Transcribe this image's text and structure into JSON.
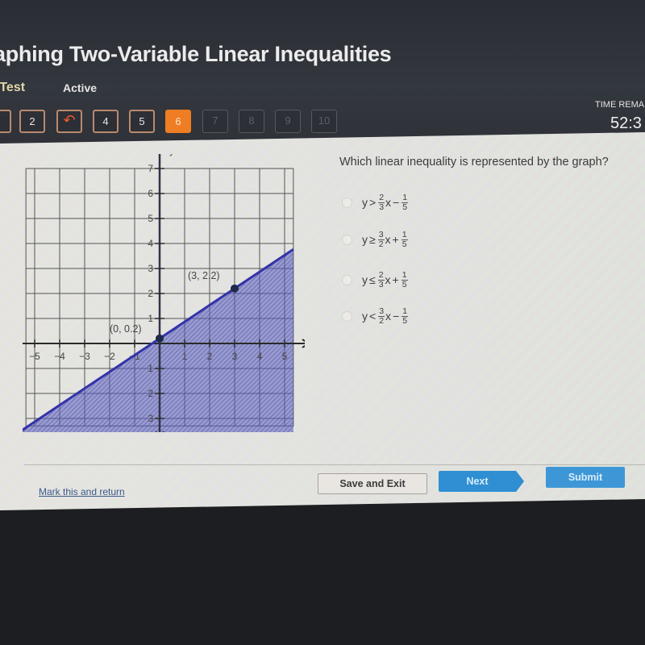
{
  "header": {
    "title": "aphing Two-Variable Linear Inequalities",
    "subtitle": "-Test",
    "status": "Active"
  },
  "question_nav": {
    "items": [
      {
        "label": "",
        "state": "answered"
      },
      {
        "label": "2",
        "state": "answered"
      },
      {
        "label": "↶",
        "state": "flagged",
        "icon": "return-arrow-icon"
      },
      {
        "label": "4",
        "state": "answered"
      },
      {
        "label": "5",
        "state": "answered"
      },
      {
        "label": "6",
        "state": "current"
      },
      {
        "label": "7",
        "state": "disabled"
      },
      {
        "label": "8",
        "state": "disabled"
      },
      {
        "label": "9",
        "state": "disabled"
      },
      {
        "label": "10",
        "state": "disabled"
      }
    ]
  },
  "timer": {
    "label": "TIME REMA",
    "value": "52:3"
  },
  "question": {
    "prompt": "Which linear inequality is represented by the graph?",
    "options": [
      {
        "lhs": "y",
        "op": ">",
        "coef_num": "2",
        "coef_den": "3",
        "var": "x",
        "sign": "−",
        "const_num": "1",
        "const_den": "5"
      },
      {
        "lhs": "y",
        "op": "≥",
        "coef_num": "3",
        "coef_den": "2",
        "var": "x",
        "sign": "+",
        "const_num": "1",
        "const_den": "5"
      },
      {
        "lhs": "y",
        "op": "≤",
        "coef_num": "2",
        "coef_den": "3",
        "var": "x",
        "sign": "+",
        "const_num": "1",
        "const_den": "5"
      },
      {
        "lhs": "y",
        "op": "<",
        "coef_num": "3",
        "coef_den": "2",
        "var": "x",
        "sign": "−",
        "const_num": "1",
        "const_den": "5"
      }
    ]
  },
  "chart_data": {
    "type": "line",
    "title": "",
    "xlabel": "x",
    "ylabel": "y",
    "xlim": [
      -5,
      5
    ],
    "ylim": [
      -3,
      7
    ],
    "x_ticks": [
      -5,
      -4,
      -3,
      -2,
      -1,
      1,
      2,
      3,
      4,
      5
    ],
    "y_ticks": [
      -3,
      -2,
      -1,
      1,
      2,
      3,
      4,
      5,
      6,
      7
    ],
    "grid": true,
    "line": {
      "slope_num": 2,
      "slope_den": 3,
      "intercept": 0.2,
      "style": "solid"
    },
    "shading": "below",
    "points": [
      {
        "x": 0,
        "y": 0.2,
        "label": "(0, 0.2)"
      },
      {
        "x": 3,
        "y": 2.2,
        "label": "(3, 2.2)"
      }
    ],
    "colors": {
      "line": "#3333aa",
      "shade": "#5a5fc0",
      "grid": "#555555"
    }
  },
  "footer": {
    "mark_link": "Mark this and return",
    "save_label": "Save and Exit",
    "next_label": "Next",
    "submit_label": "Submit"
  }
}
